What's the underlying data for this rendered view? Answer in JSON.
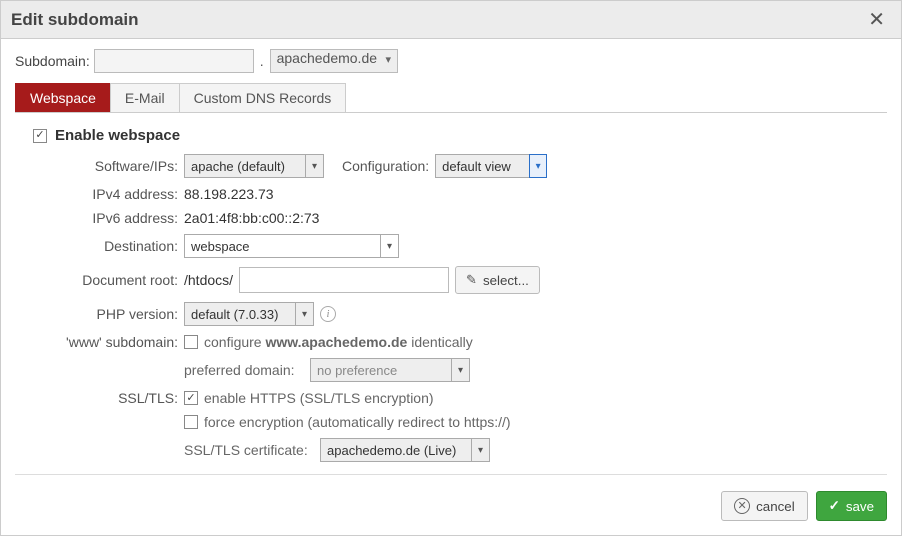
{
  "title": "Edit subdomain",
  "subdomain": {
    "label": "Subdomain:",
    "value": "",
    "domain": "apachedemo.de"
  },
  "tabs": [
    "Webspace",
    "E-Mail",
    "Custom DNS Records"
  ],
  "enable": {
    "label": "Enable webspace",
    "checked": true
  },
  "software": {
    "label": "Software/IPs:",
    "value": "apache (default)",
    "config_label": "Configuration:",
    "config_value": "default view"
  },
  "ipv4": {
    "label": "IPv4 address:",
    "value": "88.198.223.73"
  },
  "ipv6": {
    "label": "IPv6 address:",
    "value": "2a01:4f8:bb:c00::2:73"
  },
  "destination": {
    "label": "Destination:",
    "value": "webspace"
  },
  "docroot": {
    "label": "Document root:",
    "prefix": "/htdocs/",
    "value": "",
    "select_btn": "select..."
  },
  "php": {
    "label": "PHP version:",
    "value": "default (7.0.33)"
  },
  "www": {
    "label": "'www' subdomain:",
    "configure_prefix": "configure ",
    "configure_domain": "www.apachedemo.de",
    "configure_suffix": " identically",
    "checked": false,
    "pref_label": "preferred domain:",
    "pref_value": "no preference"
  },
  "ssl": {
    "label": "SSL/TLS:",
    "enable_label": "enable HTTPS (SSL/TLS encryption)",
    "enable_checked": true,
    "force_label": "force encryption (automatically redirect to https://)",
    "force_checked": false,
    "cert_label": "SSL/TLS certificate:",
    "cert_value": "apachedemo.de (Live)"
  },
  "buttons": {
    "cancel": "cancel",
    "save": "save"
  }
}
